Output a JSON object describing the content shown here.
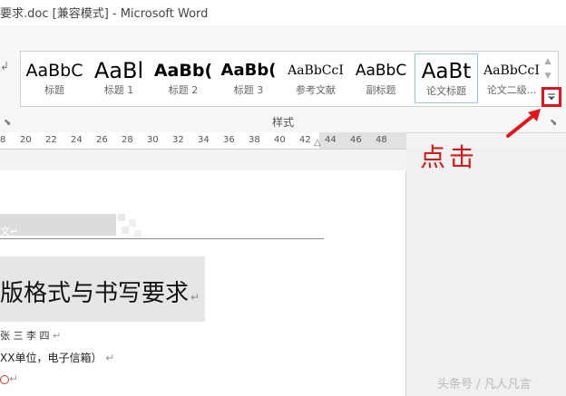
{
  "window": {
    "title": "要求.doc [兼容模式] - Microsoft Word"
  },
  "ribbon": {
    "group_label": "样式",
    "styles": [
      {
        "sample": "AaBbC",
        "name": "标题"
      },
      {
        "sample": "AaBl",
        "name": "标题 1"
      },
      {
        "sample": "AaBb(",
        "name": "标题 2"
      },
      {
        "sample": "AaBb(",
        "name": "标题 3"
      },
      {
        "sample": "AaBbCcI",
        "name": "参考文献"
      },
      {
        "sample": "AaBbC",
        "name": "副标题"
      },
      {
        "sample": "AaBt",
        "name": "论文标题"
      },
      {
        "sample": "AaBbCcI",
        "name": "论文二级..."
      }
    ],
    "selected_style": "论文标题",
    "more_button_icon": "dropdown-more-icon"
  },
  "ruler": {
    "ticks": [
      "8",
      "20",
      "22",
      "24",
      "26",
      "28",
      "30",
      "32",
      "34",
      "36",
      "38",
      "40",
      "42",
      "44",
      "46",
      "48"
    ]
  },
  "document": {
    "line1_tail": "文",
    "heading": "版格式与书写要求",
    "authors": "张 三 李 四",
    "affiliation": "XX单位，电子信箱）"
  },
  "annotation": {
    "click_text": "点击",
    "color": "#d11a1a"
  },
  "watermark": {
    "text": "头条号 / 凡人凡言"
  }
}
